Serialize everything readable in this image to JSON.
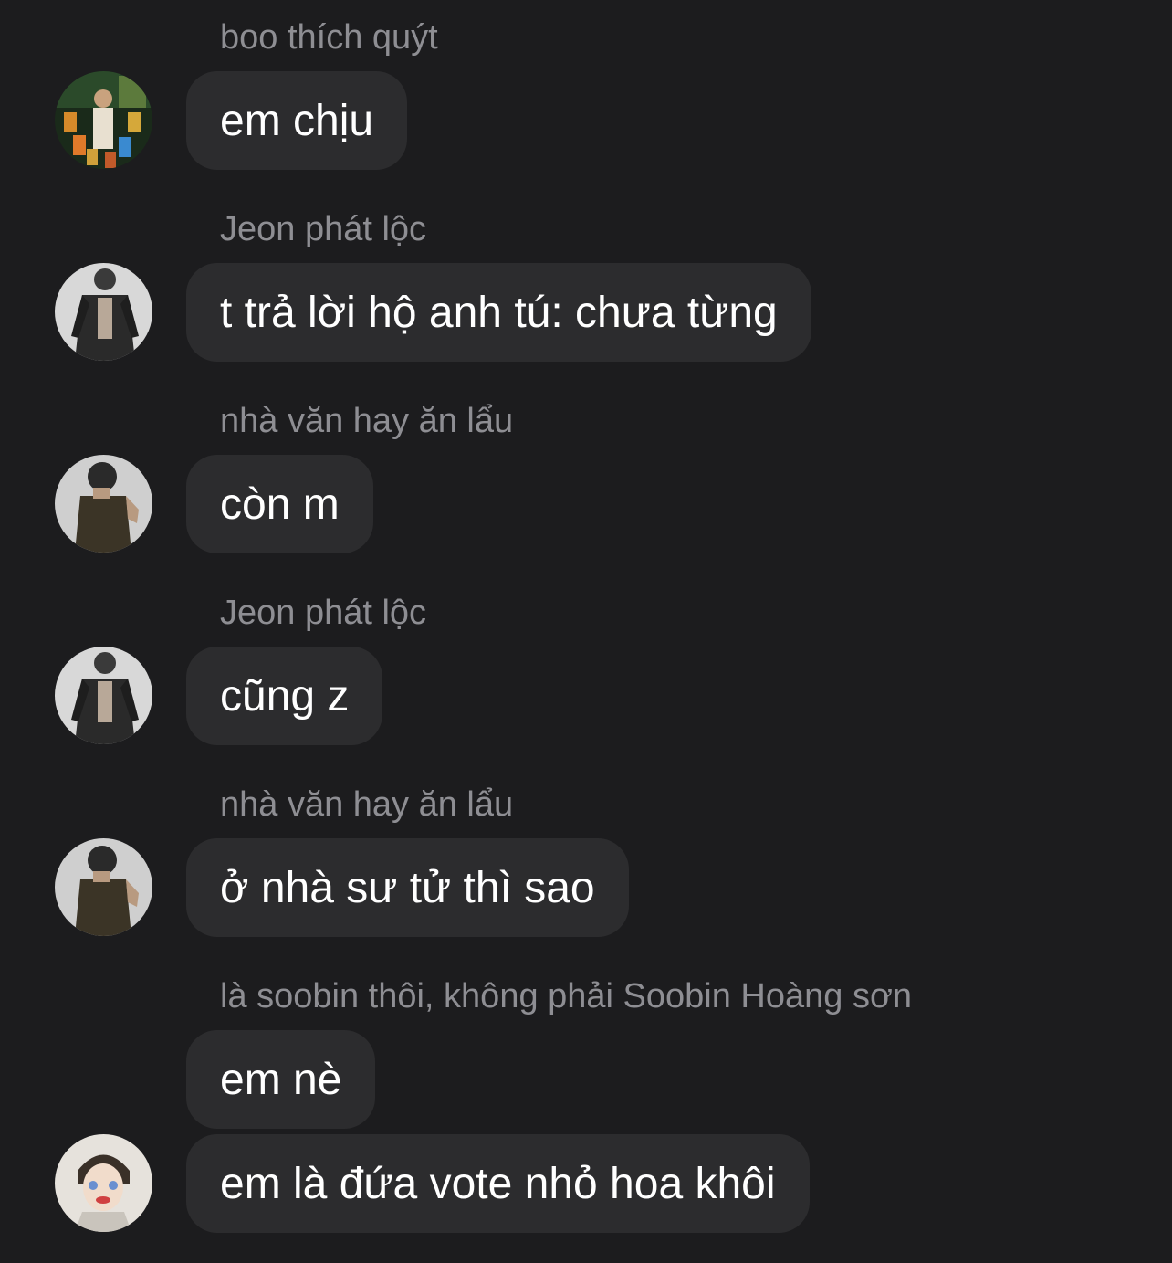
{
  "messages": [
    {
      "sender": "boo thích quýt",
      "text": "em chịu",
      "avatar": "avatar-user-boo"
    },
    {
      "sender": "Jeon phát lộc",
      "text": "t trả lời hộ anh tú: chưa từng",
      "avatar": "avatar-user-jeon"
    },
    {
      "sender": "nhà văn hay ăn lẩu",
      "text": "còn m",
      "avatar": "avatar-user-nhavan"
    },
    {
      "sender": "Jeon phát lộc",
      "text": "cũng z",
      "avatar": "avatar-user-jeon"
    },
    {
      "sender": "nhà văn hay ăn lẩu",
      "text": "ở nhà sư tử thì sao",
      "avatar": "avatar-user-nhavan"
    },
    {
      "sender": "là soobin thôi, không phải Soobin Hoàng sơn",
      "text": "em nè",
      "avatar": ""
    },
    {
      "sender": "",
      "text": "em là đứa vote nhỏ hoa khôi",
      "avatar": "avatar-user-soobin"
    }
  ],
  "colors": {
    "background": "#1c1c1e",
    "bubble": "#2c2c2e",
    "sender_text": "#8e8e93",
    "message_text": "#ffffff"
  }
}
